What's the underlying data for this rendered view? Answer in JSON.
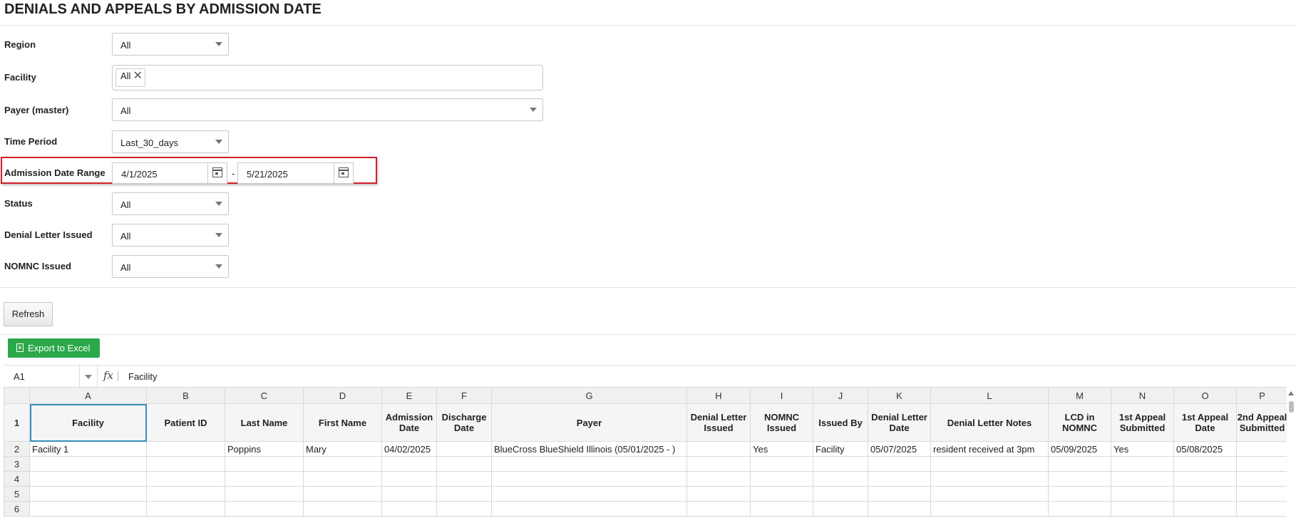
{
  "page": {
    "title": "DENIALS AND APPEALS BY ADMISSION DATE"
  },
  "filters": {
    "region": {
      "label": "Region",
      "value": "All"
    },
    "facility": {
      "label": "Facility",
      "tag": "All",
      "remove_glyph": "✕"
    },
    "payer": {
      "label": "Payer (master)",
      "value": "All"
    },
    "time_period": {
      "label": "Time Period",
      "value": "Last_30_days"
    },
    "admission_range": {
      "label": "Admission Date Range",
      "from": "4/1/2025",
      "separator": "-",
      "to": "5/21/2025"
    },
    "status": {
      "label": "Status",
      "value": "All"
    },
    "denial_letter": {
      "label": "Denial Letter Issued",
      "value": "All"
    },
    "nomnc": {
      "label": "NOMNC Issued",
      "value": "All"
    }
  },
  "buttons": {
    "refresh": "Refresh",
    "export": "Export to Excel"
  },
  "formula_bar": {
    "cell_ref": "A1",
    "fx": "fx",
    "value": "Facility"
  },
  "highlight_color": "#d32027",
  "export_color": "#2ba84a",
  "grid": {
    "col_letters": [
      "A",
      "B",
      "C",
      "D",
      "E",
      "F",
      "G",
      "H",
      "I",
      "J",
      "K",
      "L",
      "M",
      "N",
      "O",
      "P"
    ],
    "headers": [
      "Facility",
      "Patient ID",
      "Last Name",
      "First Name",
      "Admission Date",
      "Discharge Date",
      "Payer",
      "Denial Letter Issued",
      "NOMNC Issued",
      "Issued By",
      "Denial Letter Date",
      "Denial Letter Notes",
      "LCD in NOMNC",
      "1st Appeal Submitted",
      "1st Appeal Date",
      "2nd Appeal Submitted"
    ],
    "rows": [
      {
        "num": "2",
        "cells": [
          "Facility 1",
          "",
          "Poppins",
          "Mary",
          "04/02/2025",
          "",
          "BlueCross BlueShield Illinois (05/01/2025 - )",
          "",
          "Yes",
          "Facility",
          "05/07/2025",
          "resident received at 3pm",
          "05/09/2025",
          "Yes",
          "05/08/2025",
          ""
        ]
      },
      {
        "num": "3",
        "cells": [
          "",
          "",
          "",
          "",
          "",
          "",
          "",
          "",
          "",
          "",
          "",
          "",
          "",
          "",
          "",
          ""
        ]
      },
      {
        "num": "4",
        "cells": [
          "",
          "",
          "",
          "",
          "",
          "",
          "",
          "",
          "",
          "",
          "",
          "",
          "",
          "",
          "",
          ""
        ]
      },
      {
        "num": "5",
        "cells": [
          "",
          "",
          "",
          "",
          "",
          "",
          "",
          "",
          "",
          "",
          "",
          "",
          "",
          "",
          "",
          ""
        ]
      },
      {
        "num": "6",
        "cells": [
          "",
          "",
          "",
          "",
          "",
          "",
          "",
          "",
          "",
          "",
          "",
          "",
          "",
          "",
          "",
          ""
        ]
      }
    ]
  }
}
